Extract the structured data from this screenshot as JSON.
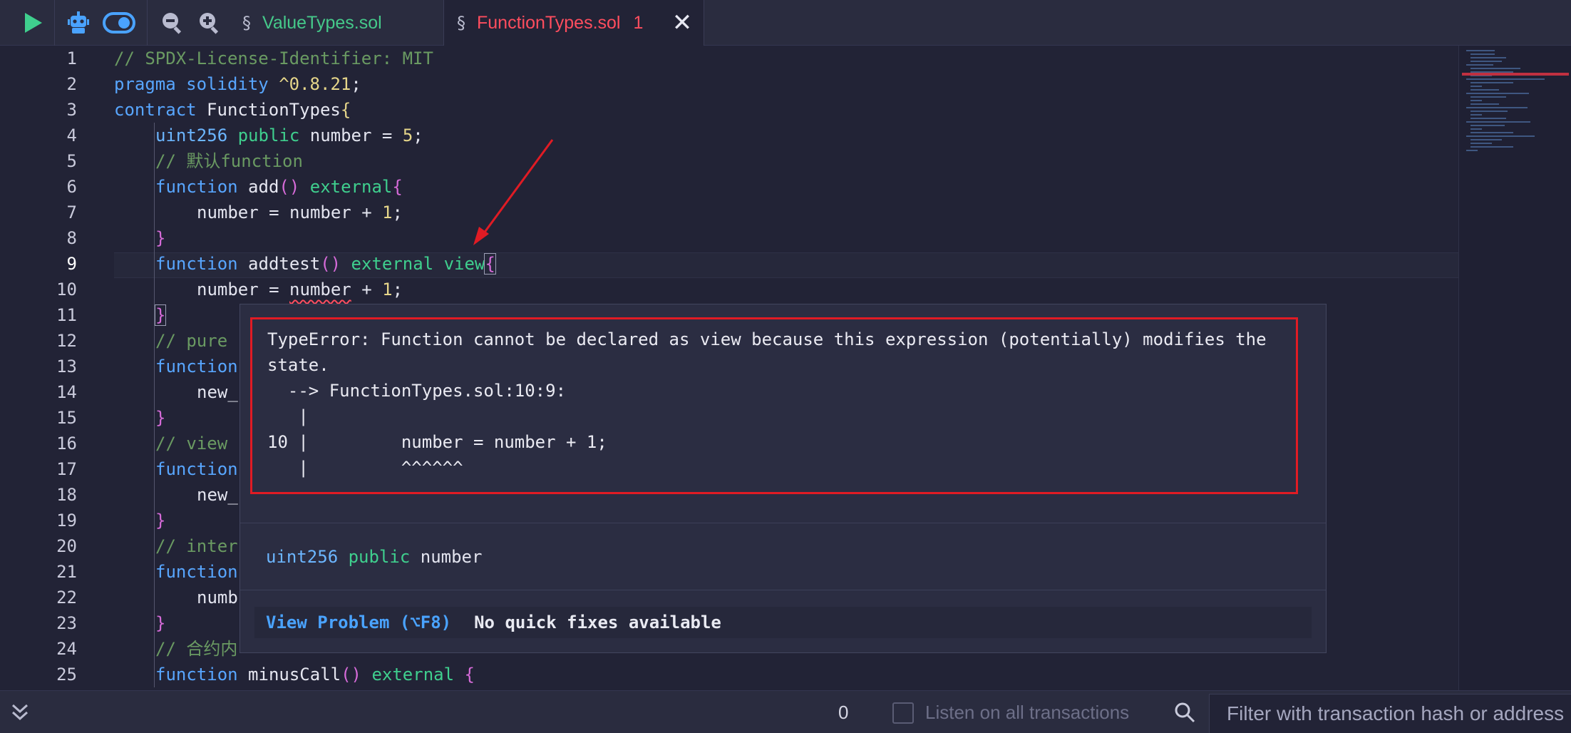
{
  "toolbar": {
    "run_icon": "play-icon",
    "bot_icon": "robot-icon",
    "toggle_icon": "toggle-icon",
    "zoom_out_icon": "zoom-out-icon",
    "zoom_in_icon": "zoom-in-icon"
  },
  "tabs": [
    {
      "label": "ValueTypes.sol",
      "icon": "solidity-file-icon",
      "color": "#45c98a"
    },
    {
      "label": "FunctionTypes.sol",
      "icon": "solidity-file-icon",
      "problems": "1",
      "color": "#ff4d5e",
      "active": true
    }
  ],
  "editor": {
    "active_line": 9,
    "line_numbers": [
      "1",
      "2",
      "3",
      "4",
      "5",
      "6",
      "7",
      "8",
      "9",
      "10",
      "11",
      "12",
      "13",
      "14",
      "15",
      "16",
      "17",
      "18",
      "19",
      "20",
      "21",
      "22",
      "23",
      "24",
      "25"
    ],
    "code": {
      "l1": "// SPDX-License-Identifier: MIT",
      "l2_kw": "pragma solidity",
      "l2_ver": " ^0.8.21",
      "l2_end": ";",
      "l3_kw": "contract",
      "l3_name": " FunctionTypes",
      "l3_brace": "{",
      "l4_type": "uint256",
      "l4_mod": " public",
      "l4_rest": " number = ",
      "l4_num": "5",
      "l4_end": ";",
      "l5": "// 默认function",
      "l6_kw": "function",
      "l6_name": " add",
      "l6_paren": "()",
      "l6_ext": " external",
      "l6_brace": "{",
      "l7_rest": "number = number + ",
      "l7_num": "1",
      "l7_end": ";",
      "l8": "}",
      "l9_kw": "function",
      "l9_name": " addtest",
      "l9_paren": "()",
      "l9_ext": " external view",
      "l9_brace": "{",
      "l10_a": "number = ",
      "l10_b": "number",
      "l10_c": " + ",
      "l10_num": "1",
      "l10_end": ";",
      "l11": "}",
      "l12": "// pure",
      "l13": "function",
      "l14": "new_",
      "l15": "}",
      "l16": "// view",
      "l17": "function",
      "l18": "new_",
      "l19": "}",
      "l20": "// inter",
      "l21": "function",
      "l22": "numb",
      "l23": "}",
      "l24": "// 合约内",
      "l25_kw": "function",
      "l25_name": " minusCall",
      "l25_paren": "()",
      "l25_ext": " external ",
      "l25_brace": "{"
    }
  },
  "hover": {
    "error_lines": [
      "TypeError: Function cannot be declared as view because this expression (potentially) modifies the",
      "state.",
      "  --> FunctionTypes.sol:10:9:",
      "   |",
      "10 |         number = number + 1;",
      "   |         ^^^^^^"
    ],
    "signature_type": "uint256",
    "signature_mod": " public",
    "signature_name": " number",
    "view_problem": "View Problem (⌥F8)",
    "no_fixes": "No quick fixes available"
  },
  "bottombar": {
    "tx_count": "0",
    "listen_label": "Listen on all transactions",
    "listen_checked": false,
    "filter_placeholder": "Filter with transaction hash or address"
  },
  "colors": {
    "background": "#222336",
    "error": "#e01b24",
    "accent_blue": "#58a6ff",
    "accent_green": "#3fcf8e"
  }
}
